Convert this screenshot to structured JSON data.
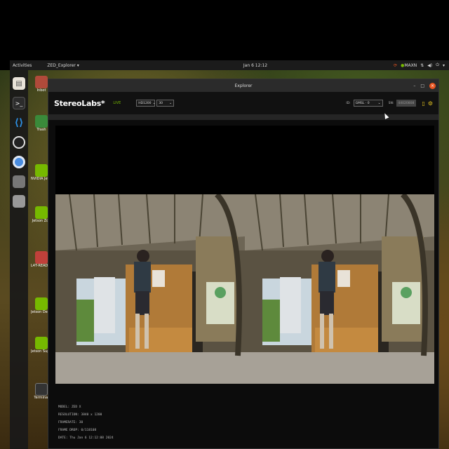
{
  "topbar": {
    "activities": "Activities",
    "app_menu": "ZED_Explorer ▾",
    "clock": "Jan 6 12:12",
    "power_mode": "MAXN"
  },
  "dock": {
    "items": [
      "files-icon",
      "terminal-icon",
      "vscode-icon",
      "obs-icon",
      "chromium-icon",
      "app-icon",
      "disk-icon"
    ]
  },
  "desktop": {
    "items": [
      {
        "label": "Inbot"
      },
      {
        "label": "Trash"
      },
      {
        "label": "NVIDIA Jetson Community"
      },
      {
        "label": "Jetson Zoo"
      },
      {
        "label": "L4T-README"
      },
      {
        "label": "Jetson Developer Z"
      },
      {
        "label": "Jetson Support Forums"
      },
      {
        "label": "Terminal"
      }
    ]
  },
  "window": {
    "title": "Explorer"
  },
  "toolbar": {
    "brand": "StereoLabs*",
    "live": "LIVE",
    "resolution": "HD1200",
    "fps": "30",
    "id_label": "ID:",
    "id_value": "GMSL · 0",
    "sn_label": "SN:",
    "sn_value": "44020808"
  },
  "info": {
    "model": "MODEL: ZED X",
    "resolution": "RESOLUTION: 3840 x 1200",
    "framerate": "FRAMERATE: 30",
    "frame_drop": "FRAME DROP: 0/118108",
    "date": "DATE: Thu Jan 6 12:12:08 2024"
  },
  "colors": {
    "accent": "#76b900",
    "close": "#e95420",
    "brand_text": "#ffffff"
  }
}
